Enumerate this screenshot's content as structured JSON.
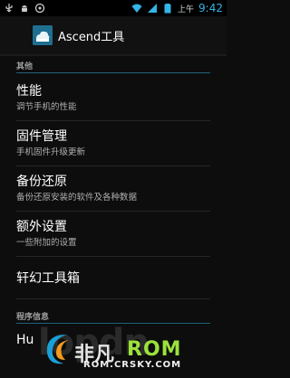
{
  "status_bar": {
    "ampm": "上午",
    "time": "9:42"
  },
  "action_bar": {
    "title": "Ascend工具"
  },
  "sections": [
    {
      "header": "其他"
    },
    {
      "header": "程序信息"
    }
  ],
  "items": [
    {
      "title": "性能",
      "subtitle": "调节手机的性能"
    },
    {
      "title": "固件管理",
      "subtitle": "手机固件升级更新"
    },
    {
      "title": "备份还原",
      "subtitle": "备份还原安装的软件及各种数据"
    },
    {
      "title": "额外设置",
      "subtitle": "一些附加的设置"
    },
    {
      "title": "轩幻工具箱",
      "subtitle": ""
    },
    {
      "title": "Hu",
      "subtitle": ""
    }
  ],
  "watermark": {
    "faint": "lopdn",
    "brand_cn": "非凡",
    "brand_rom": "ROM",
    "url": "ROM.CRSKY.COM"
  },
  "colors": {
    "accent": "#33b5e5",
    "brand_green": "#9be23b"
  }
}
